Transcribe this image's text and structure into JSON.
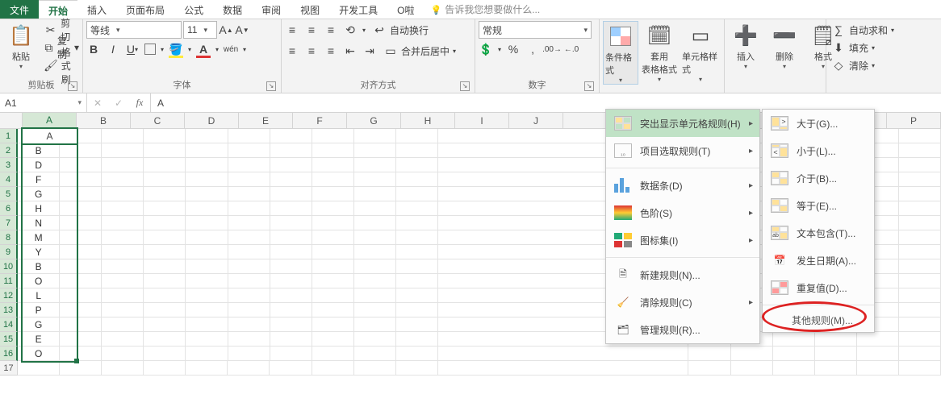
{
  "tabs": {
    "file": "文件",
    "home": "开始",
    "insert": "插入",
    "layout": "页面布局",
    "formulas": "公式",
    "data": "数据",
    "review": "审阅",
    "view": "视图",
    "developer": "开发工具",
    "opa": "O啦",
    "tellme": "告诉我您想要做什么..."
  },
  "ribbon": {
    "clipboard": {
      "paste": "粘贴",
      "cut": "剪切",
      "copy": "复制",
      "fmtpainter": "格式刷",
      "label": "剪贴板"
    },
    "font": {
      "name": "等线",
      "size": "11",
      "label": "字体",
      "phonetic": "wén"
    },
    "align": {
      "wrap": "自动换行",
      "merge": "合并后居中",
      "label": "对齐方式"
    },
    "number": {
      "fmt": "常规",
      "label": "数字"
    },
    "styles": {
      "cond": "条件格式",
      "tbl": "套用\n表格格式",
      "cell": "单元格样式",
      "label": ""
    },
    "cells": {
      "ins": "插入",
      "del": "删除",
      "fmt": "格式",
      "label": ""
    },
    "editing": {
      "sum": "自动求和",
      "fill": "填充",
      "clear": "清除"
    }
  },
  "formula_bar": {
    "namebox": "A1",
    "content": "A"
  },
  "columns": [
    "A",
    "B",
    "C",
    "D",
    "E",
    "F",
    "G",
    "H",
    "I",
    "J",
    "P"
  ],
  "rows_count": 17,
  "cells_A": [
    "A",
    "B",
    "D",
    "F",
    "G",
    "H",
    "N",
    "M",
    "Y",
    "B",
    "O",
    "L",
    "P",
    "G",
    "E",
    "O"
  ],
  "menu1": {
    "highlight": "突出显示单元格规则(H)",
    "top": "项目选取规则(T)",
    "databars": "数据条(D)",
    "colorscales": "色阶(S)",
    "iconsets": "图标集(I)",
    "new": "新建规则(N)...",
    "clear": "清除规则(C)",
    "manage": "管理规则(R)..."
  },
  "menu2": {
    "gt": "大于(G)...",
    "lt": "小于(L)...",
    "between": "介于(B)...",
    "eq": "等于(E)...",
    "contains": "文本包含(T)...",
    "date": "发生日期(A)...",
    "dup": "重复值(D)...",
    "other": "其他规则(M)..."
  }
}
